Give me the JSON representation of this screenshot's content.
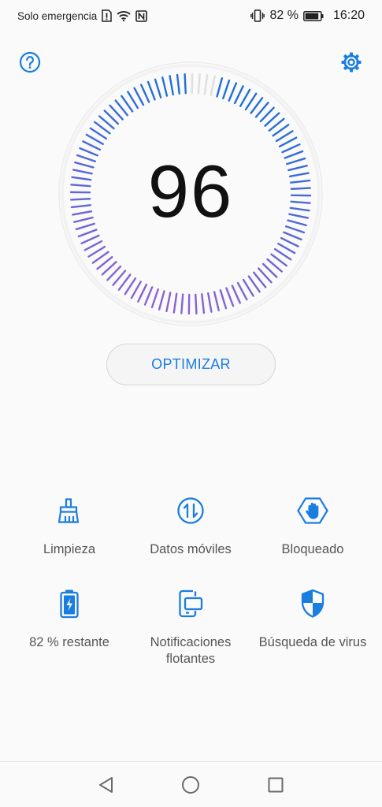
{
  "status_bar": {
    "carrier": "Solo emergencia",
    "battery_percent": "82 %",
    "time": "16:20",
    "icons": [
      "sim-alert-icon",
      "wifi-icon",
      "nfc-icon",
      "vibrate-icon",
      "battery-icon"
    ]
  },
  "header": {
    "help_icon": "help-circle-icon",
    "settings_icon": "gear-icon"
  },
  "dial": {
    "score": "96",
    "progress_fraction": 0.96,
    "colors": {
      "start": "#1e6fd9",
      "end": "#8a63d2",
      "inactive": "#dedede"
    }
  },
  "optimize_button": {
    "label": "OPTIMIZAR",
    "color": "#1a7de0"
  },
  "tiles": [
    {
      "label": "Limpieza",
      "icon": "broom-icon"
    },
    {
      "label": "Datos móviles",
      "icon": "data-transfer-icon"
    },
    {
      "label": "Bloqueado",
      "icon": "block-hand-icon"
    },
    {
      "label": "82 % restante",
      "icon": "battery-charge-icon"
    },
    {
      "label": "Notificaciones flotantes",
      "icon": "floating-notification-icon"
    },
    {
      "label": "Búsqueda de virus",
      "icon": "shield-icon"
    }
  ],
  "nav_bar": {
    "icons": [
      "back-icon",
      "home-icon",
      "recent-apps-icon"
    ]
  },
  "accent_color": "#1a7de0"
}
